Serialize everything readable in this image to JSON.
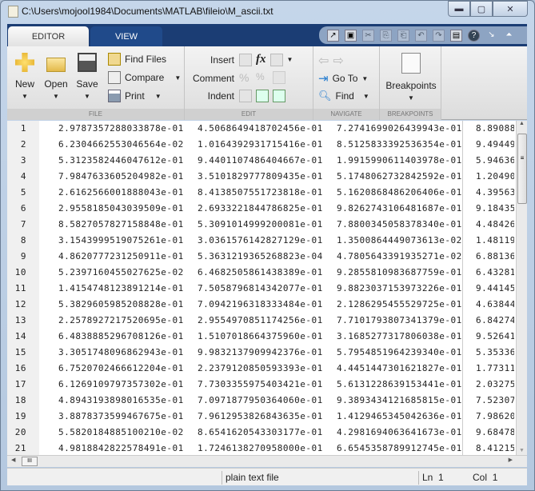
{
  "window": {
    "title": "C:\\Users\\mojool1984\\Documents\\MATLAB\\fileio\\M_ascii.txt"
  },
  "tabs": [
    {
      "label": "EDITOR"
    },
    {
      "label": "VIEW"
    }
  ],
  "toolbar": {
    "file": {
      "label": "FILE",
      "new": "New",
      "open": "Open",
      "save": "Save",
      "find_files": "Find Files",
      "compare": "Compare",
      "print": "Print"
    },
    "edit": {
      "label": "EDIT",
      "insert": "Insert",
      "comment": "Comment",
      "indent": "Indent"
    },
    "navigate": {
      "label": "NAVIGATE",
      "goto": "Go To",
      "find": "Find"
    },
    "breakpoints": {
      "label": "BREAKPOINTS",
      "button": "Breakpoints"
    }
  },
  "rows": [
    [
      "1",
      "2.9787357288033878e-01",
      "4.5068649418702456e-01",
      "7.2741699026439943e-01",
      "8.89088"
    ],
    [
      "2",
      "6.2304662553046564e-02",
      "1.0164392931715416e-01",
      "8.5125833392536354e-01",
      "9.49449"
    ],
    [
      "3",
      "5.3123582446047612e-01",
      "9.4401107486404667e-01",
      "1.9915990611403978e-01",
      "5.94636"
    ],
    [
      "4",
      "7.9847633605204982e-01",
      "3.5101829777809435e-01",
      "5.1748062732842592e-01",
      "1.20490"
    ],
    [
      "5",
      "2.6162566001888043e-01",
      "8.4138507551723818e-01",
      "5.1620868486206406e-01",
      "4.39563"
    ],
    [
      "6",
      "2.9558185043039509e-01",
      "2.6933221844786825e-01",
      "9.8262743106481687e-01",
      "9.18435"
    ],
    [
      "7",
      "8.5827057827158848e-01",
      "5.3091014999200081e-01",
      "7.8800345058378340e-01",
      "4.48426"
    ],
    [
      "8",
      "3.1543999519075261e-01",
      "3.0361576142827129e-01",
      "1.3500864449073613e-02",
      "1.48119"
    ],
    [
      "9",
      "4.8620777231250911e-01",
      "5.3631219365268823e-04",
      "4.7805643391935271e-02",
      "6.88136"
    ],
    [
      "10",
      "5.2397160455027625e-02",
      "6.4682505861438389e-01",
      "9.2855810983687759e-01",
      "6.43281"
    ],
    [
      "11",
      "1.4154748123891214e-01",
      "7.5058796814342077e-01",
      "9.8823037153973226e-01",
      "9.44145"
    ],
    [
      "12",
      "5.3829605985208828e-01",
      "7.0942196318333484e-01",
      "2.1286295455529725e-01",
      "4.63844"
    ],
    [
      "13",
      "2.2578927217520695e-01",
      "2.9554970851174256e-01",
      "7.7101793807341379e-01",
      "6.84274"
    ],
    [
      "14",
      "6.4838885296708126e-01",
      "1.5107018664375960e-01",
      "3.1685277317806038e-01",
      "9.52641"
    ],
    [
      "15",
      "3.3051748096862943e-01",
      "9.9832137909942376e-01",
      "5.7954851964239340e-01",
      "5.35336"
    ],
    [
      "16",
      "6.7520702466612204e-01",
      "2.2379120850593393e-01",
      "4.4451447301621827e-01",
      "1.77311"
    ],
    [
      "17",
      "6.1269109797357302e-01",
      "7.7303355975403421e-01",
      "5.6131228639153441e-01",
      "2.03275"
    ],
    [
      "18",
      "4.8943193898016535e-01",
      "7.0971877950364060e-01",
      "9.3893434121685815e-01",
      "7.52307"
    ],
    [
      "19",
      "3.8878373599467675e-01",
      "7.9612953826843635e-01",
      "1.4129465345042636e-01",
      "7.98620"
    ],
    [
      "20",
      "5.5820184885100210e-02",
      "8.6541620543303177e-01",
      "4.2981694063641673e-01",
      "9.68478"
    ],
    [
      "21",
      "4.9818842822578491e-01",
      "1.7246138270958000e-01",
      "6.6545358789912745e-01",
      "8.41215"
    ]
  ],
  "status": {
    "file_type": "plain text file",
    "ln_label": "Ln",
    "ln": "1",
    "col_label": "Col",
    "col": "1"
  }
}
